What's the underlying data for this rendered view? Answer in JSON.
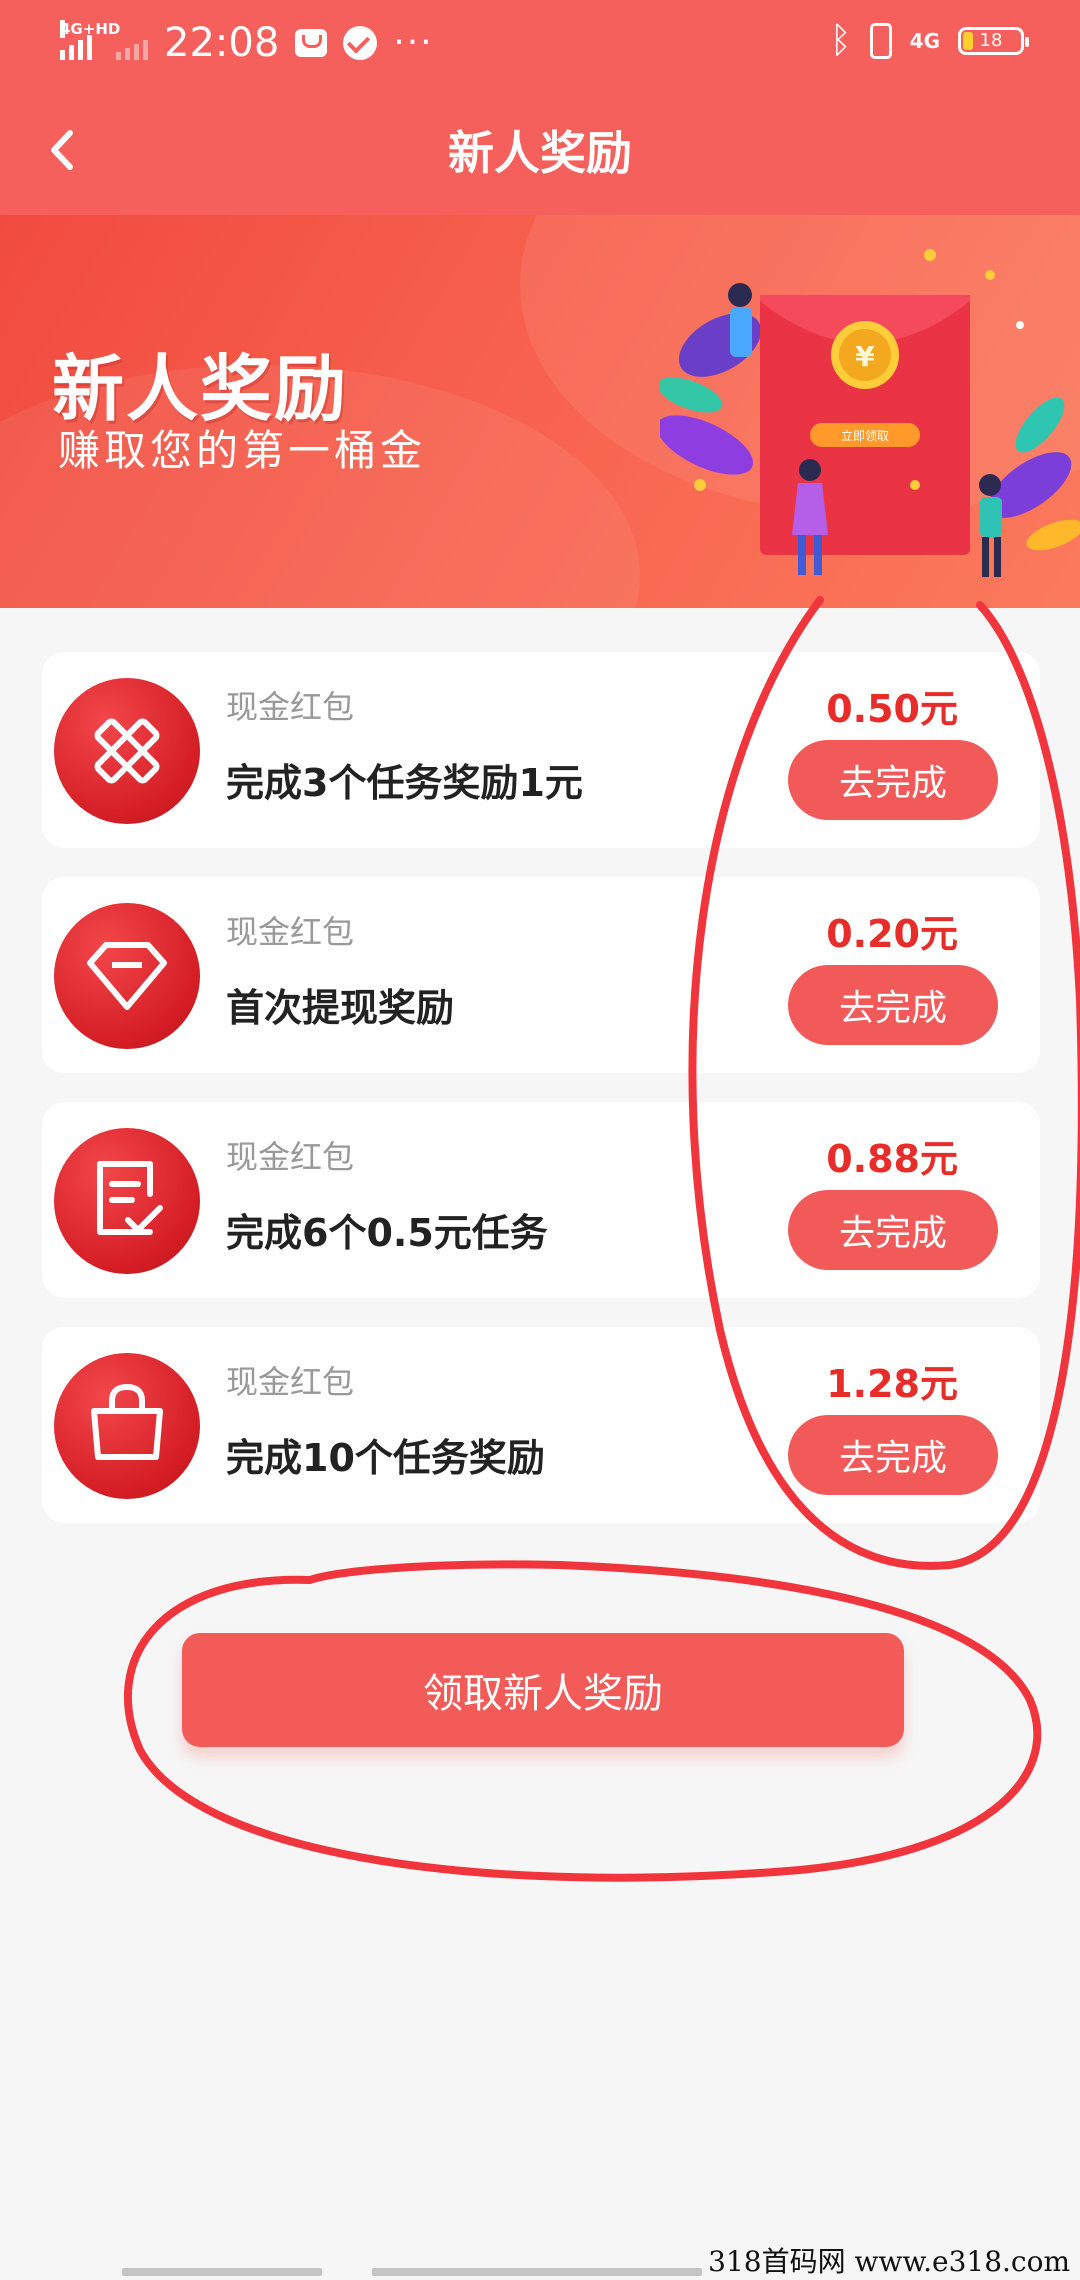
{
  "status_bar": {
    "network_left": "4G+HD",
    "time": "22:08",
    "network_right": "4G",
    "battery": "18"
  },
  "nav": {
    "back_icon": "chevron-left-icon",
    "title": "新人奖励"
  },
  "banner": {
    "title": "新人奖励",
    "subtitle": "赚取您的第一桶金",
    "art_button_text": "立即领取",
    "art_coin_symbol": "¥"
  },
  "tasks": [
    {
      "category": "现金红包",
      "title": "完成3个任务奖励1元",
      "amount": "0.50元",
      "button": "去完成",
      "icon": "pencil-ruler-icon"
    },
    {
      "category": "现金红包",
      "title": "首次提现奖励",
      "amount": "0.20元",
      "button": "去完成",
      "icon": "diamond-icon"
    },
    {
      "category": "现金红包",
      "title": "完成6个0.5元任务",
      "amount": "0.88元",
      "button": "去完成",
      "icon": "document-check-icon"
    },
    {
      "category": "现金红包",
      "title": "完成10个任务奖励",
      "amount": "1.28元",
      "button": "去完成",
      "icon": "shopping-bag-icon"
    }
  ],
  "claim_button": "领取新人奖励",
  "watermark": "318首码网  www.e318.com",
  "colors": {
    "header": "#f5605c",
    "accent_red": "#e72d2a",
    "button": "#f25a59",
    "annotation": "#f0353d"
  }
}
